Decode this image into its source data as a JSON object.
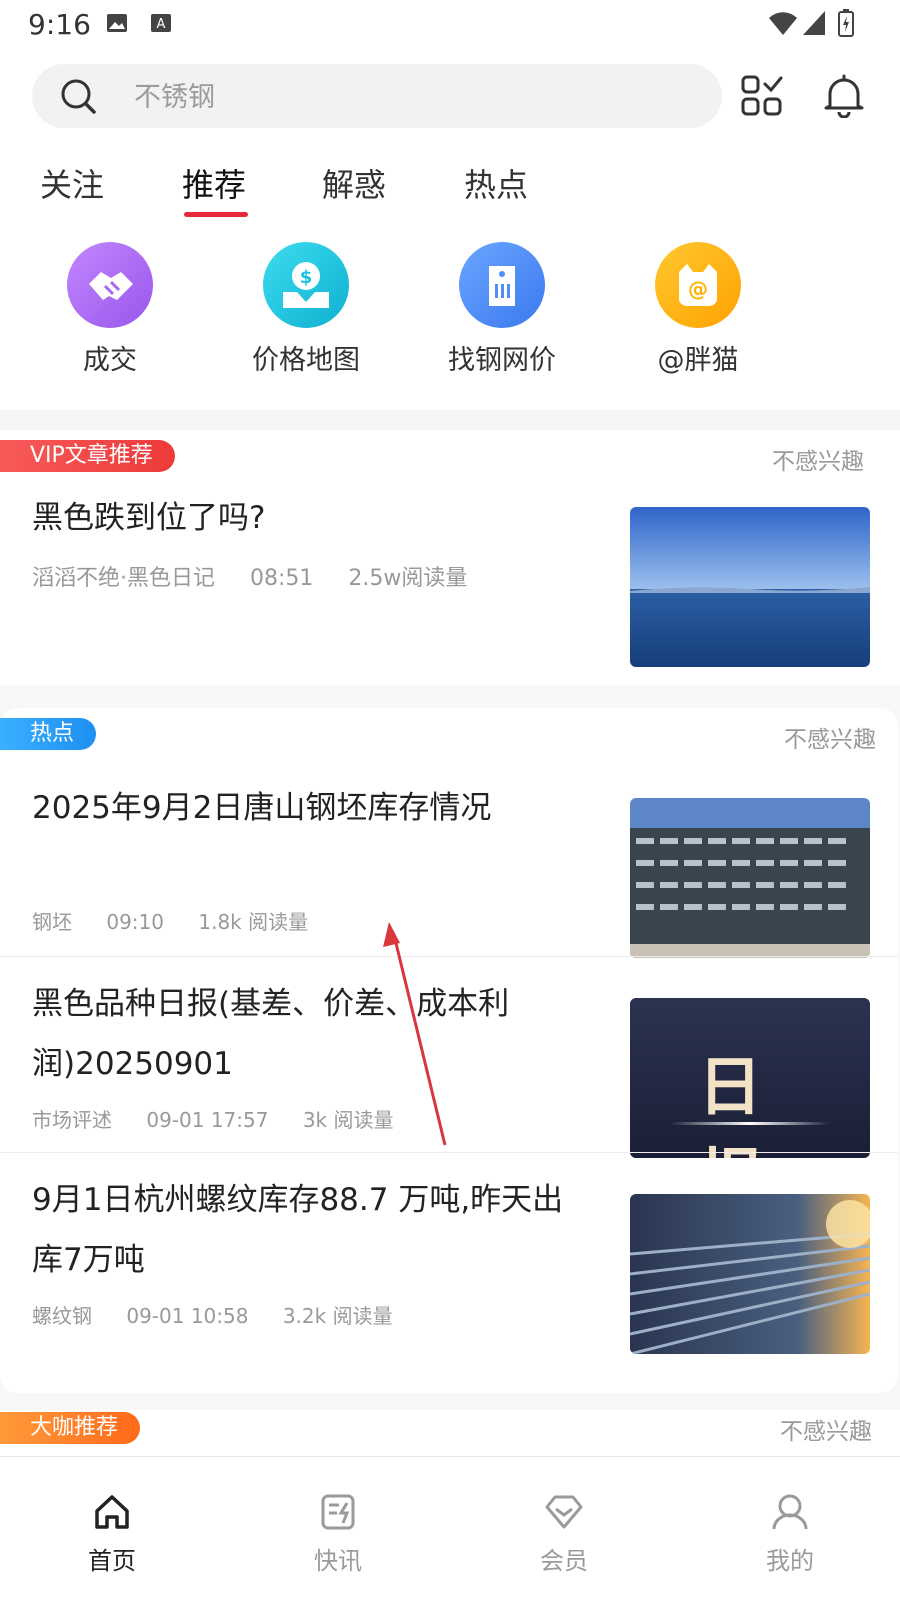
{
  "status": {
    "time": "9:16"
  },
  "search": {
    "placeholder": "不锈钢"
  },
  "tabs": [
    {
      "label": "关注"
    },
    {
      "label": "推荐",
      "active": true
    },
    {
      "label": "解惑"
    },
    {
      "label": "热点"
    }
  ],
  "quick_links": [
    {
      "label": "成交",
      "icon": "handshake-icon",
      "color": "#b06cf2"
    },
    {
      "label": "价格地图",
      "icon": "price-map-icon",
      "color": "#18c3dd"
    },
    {
      "label": "找钢网价",
      "icon": "price-tag-icon",
      "color": "#4f8ff6"
    },
    {
      "label": "@胖猫",
      "icon": "cat-icon",
      "color": "#ffb100"
    }
  ],
  "vip_article": {
    "badge": "VIP文章推荐",
    "not_interested": "不感兴趣",
    "title": "黑色跌到位了吗?",
    "author": "滔滔不绝·黑色日记",
    "time": "08:51",
    "reads": "2.5w阅读量"
  },
  "hot": {
    "badge": "热点",
    "not_interested": "不感兴趣",
    "articles": [
      {
        "title": "2025年9月2日唐山钢坯库存情况",
        "tag": "钢坯",
        "time": "09:10",
        "reads": "1.8k 阅读量"
      },
      {
        "title": "黑色品种日报(基差、价差、成本利润)20250901",
        "tag": "市场评述",
        "time": "09-01 17:57",
        "reads": "3k 阅读量",
        "thumb_text": "日 报"
      },
      {
        "title": "9月1日杭州螺纹库存88.7 万吨,昨天出库7万吨",
        "tag": "螺纹钢",
        "time": "09-01 10:58",
        "reads": "3.2k 阅读量"
      }
    ]
  },
  "next_section": {
    "badge": "大咖推荐",
    "not_interested": "不感兴趣"
  },
  "tabbar": [
    {
      "label": "首页",
      "icon": "home-icon",
      "active": true
    },
    {
      "label": "快讯",
      "icon": "news-icon"
    },
    {
      "label": "会员",
      "icon": "member-icon"
    },
    {
      "label": "我的",
      "icon": "profile-icon"
    }
  ],
  "colors": {
    "accent": "#e8283a",
    "hot_badge": "#1e9bf0",
    "vip_badge": "#f04545",
    "next_badge": "#ff7a1a"
  }
}
